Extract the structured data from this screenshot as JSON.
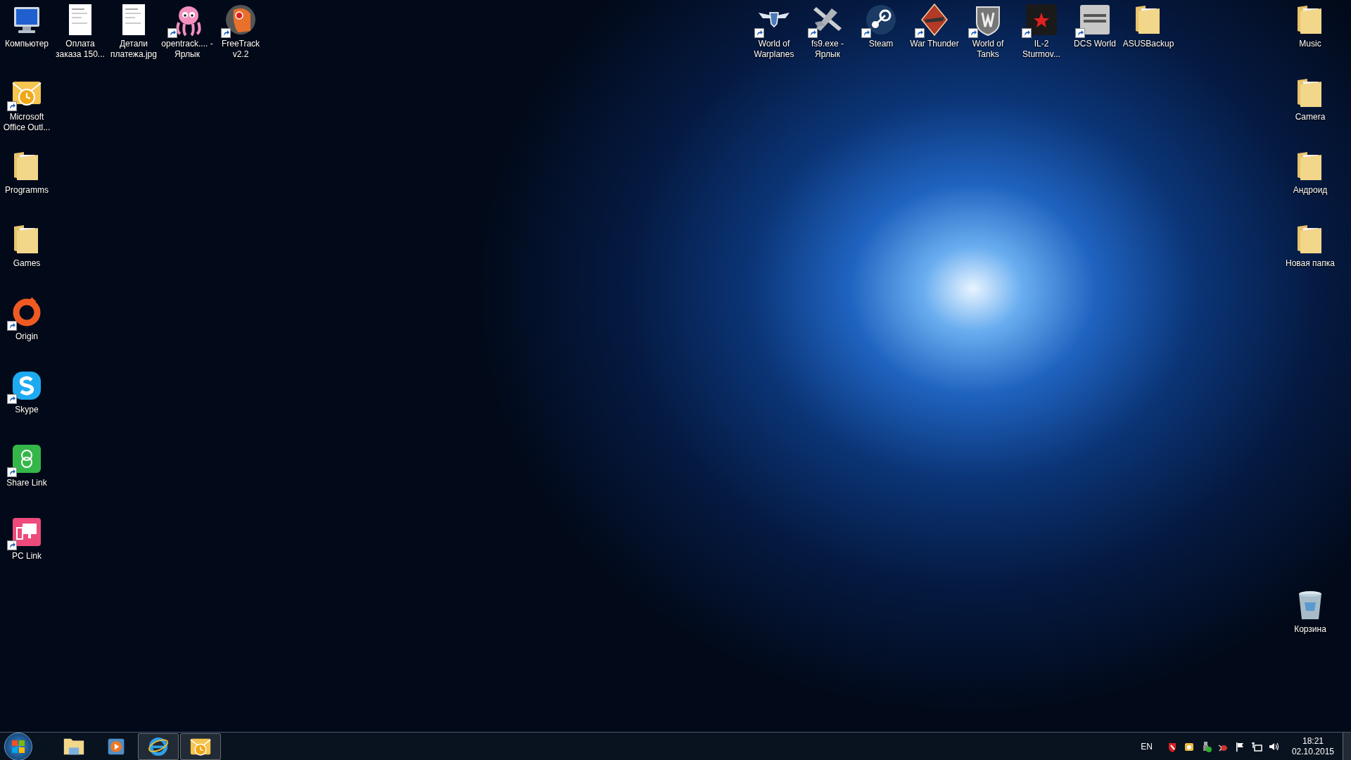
{
  "desktop": {
    "top_left_icons": [
      {
        "label": "Компьютер",
        "kind": "computer",
        "shortcut": false
      },
      {
        "label": "Оплата заказа 150...",
        "kind": "document",
        "shortcut": false
      },
      {
        "label": "Детали платежа.jpg",
        "kind": "document",
        "shortcut": false
      },
      {
        "label": "opentrack.... - Ярлык",
        "kind": "octopus",
        "shortcut": true
      },
      {
        "label": "FreeTrack v2.2",
        "kind": "freetrack",
        "shortcut": true
      }
    ],
    "left_column_icons": [
      {
        "label": "Microsoft Office Outl...",
        "kind": "outlook",
        "shortcut": true
      },
      {
        "label": "Programms",
        "kind": "folder",
        "shortcut": false
      },
      {
        "label": "Games",
        "kind": "folder",
        "shortcut": false
      },
      {
        "label": "Origin",
        "kind": "origin",
        "shortcut": true
      },
      {
        "label": "Skype",
        "kind": "skype",
        "shortcut": true
      },
      {
        "label": "Share Link",
        "kind": "sharelink",
        "shortcut": true
      },
      {
        "label": "PC Link",
        "kind": "pclink",
        "shortcut": true
      }
    ],
    "top_right_icons": [
      {
        "label": "World of Warplanes",
        "kind": "wings",
        "shortcut": true
      },
      {
        "label": "fs9.exe - Ярлык",
        "kind": "plane",
        "shortcut": true
      },
      {
        "label": "Steam",
        "kind": "steam",
        "shortcut": true
      },
      {
        "label": "War Thunder",
        "kind": "diamond",
        "shortcut": true
      },
      {
        "label": "World of Tanks",
        "kind": "tanks",
        "shortcut": true
      },
      {
        "label": "IL-2 Sturmov...",
        "kind": "star",
        "shortcut": true
      },
      {
        "label": "DCS World",
        "kind": "dcs",
        "shortcut": true
      },
      {
        "label": "ASUSBackup",
        "kind": "folder",
        "shortcut": false
      }
    ],
    "right_column_icons": [
      {
        "label": "Music",
        "kind": "folder",
        "shortcut": false
      },
      {
        "label": "Camera",
        "kind": "folder",
        "shortcut": false
      },
      {
        "label": "Андроид",
        "kind": "folder",
        "shortcut": false
      },
      {
        "label": "Новая папка",
        "kind": "folder",
        "shortcut": false
      }
    ],
    "recycle_bin": {
      "label": "Корзина",
      "kind": "recycle",
      "shortcut": false
    }
  },
  "taskbar": {
    "pinned": [
      {
        "kind": "explorer",
        "running": false
      },
      {
        "kind": "player",
        "running": false
      },
      {
        "kind": "browser",
        "running": true
      },
      {
        "kind": "outlook",
        "running": true
      }
    ],
    "language": "EN",
    "tray_icons": [
      {
        "kind": "shield"
      },
      {
        "kind": "outlook"
      },
      {
        "kind": "usb"
      },
      {
        "kind": "bug"
      },
      {
        "kind": "flag"
      },
      {
        "kind": "network"
      },
      {
        "kind": "speaker"
      }
    ],
    "time": "18:21",
    "date": "02.10.2015"
  }
}
